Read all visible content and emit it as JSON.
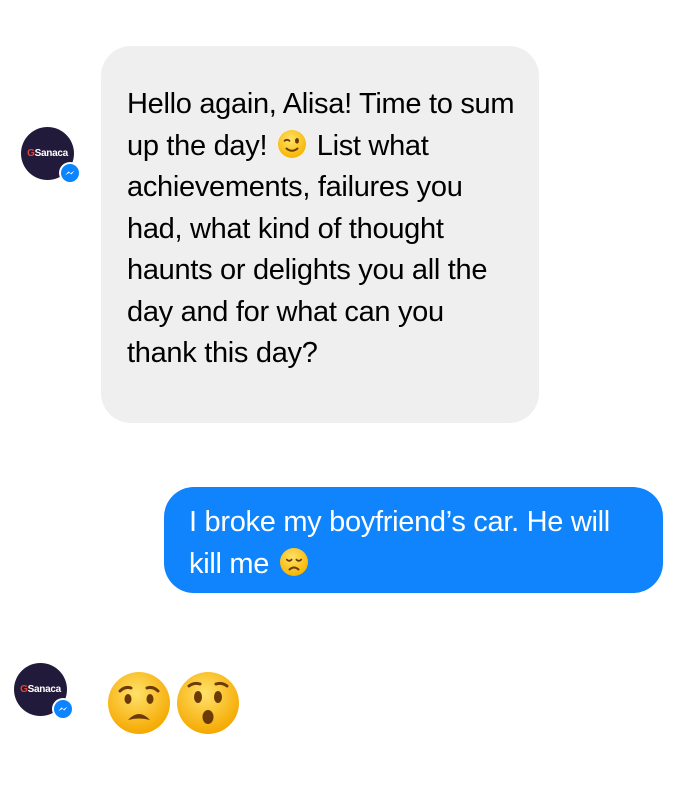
{
  "conversation": {
    "bot": {
      "avatar_brand": "Sanaca",
      "avatar_mark": "G",
      "badge_icon": "messenger-icon"
    },
    "messages": [
      {
        "sender": "bot",
        "text_before_emoji": "Hello again, Alisa! Time to sum up the day!",
        "emoji": "winking-face",
        "text_after_emoji": "List what achievements, failures you had, what kind of thought haunts or delights you all the day and for what can you thank this day?"
      },
      {
        "sender": "user",
        "text_before_emoji": "I broke my boyfriend’s car. He will kill me",
        "emoji": "disappointed-face"
      },
      {
        "sender": "bot",
        "emojis": [
          "anguished-face",
          "hushed-face"
        ]
      }
    ]
  },
  "colors": {
    "incoming_bubble": "#efefef",
    "outgoing_bubble": "#0f84fc",
    "avatar_bg": "#211a3a",
    "messenger_blue": "#0a84ff",
    "emoji_yellow": "#ffc93d"
  }
}
